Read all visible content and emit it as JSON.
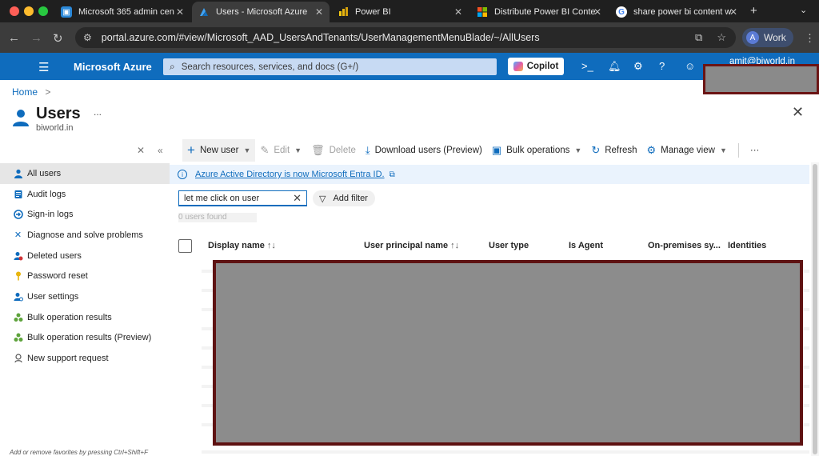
{
  "browser": {
    "tabs": [
      {
        "label": "Microsoft 365 admin cen",
        "active": false
      },
      {
        "label": "Users - Microsoft Azure",
        "active": true
      },
      {
        "label": "Power BI",
        "active": false
      },
      {
        "label": "Distribute Power BI Conte",
        "active": false
      },
      {
        "label": "share power bi content w",
        "active": false
      }
    ],
    "new_tab": "+",
    "url": "portal.azure.com/#view/Microsoft_AAD_UsersAndTenants/UserManagementMenuBlade/~/AllUsers",
    "profile": {
      "initial": "A",
      "label": "Work"
    }
  },
  "azure_header": {
    "brand": "Microsoft Azure",
    "search_placeholder": "Search resources, services, and docs (G+/)",
    "copilot_label": "Copilot",
    "account": "amit@biworld.in"
  },
  "breadcrumb": {
    "home": "Home",
    "separator": ">"
  },
  "page": {
    "title": "Users",
    "more": "...",
    "tenant": "biworld.in",
    "close": "✕"
  },
  "toolbar": {
    "new_user": "New user",
    "edit": "Edit",
    "delete": "Delete",
    "download": "Download users (Preview)",
    "bulk": "Bulk operations",
    "refresh": "Refresh",
    "manage_view": "Manage view",
    "more": "···"
  },
  "sidebar": {
    "items": [
      {
        "label": "All users",
        "icon": "user-icon",
        "active": true
      },
      {
        "label": "Audit logs",
        "icon": "audit-log-icon",
        "active": false
      },
      {
        "label": "Sign-in logs",
        "icon": "sign-in-icon",
        "active": false
      },
      {
        "label": "Diagnose and solve problems",
        "icon": "wrench-icon",
        "active": false
      },
      {
        "label": "Deleted users",
        "icon": "deleted-user-icon",
        "active": false
      },
      {
        "label": "Password reset",
        "icon": "key-icon",
        "active": false
      },
      {
        "label": "User settings",
        "icon": "user-settings-icon",
        "active": false
      },
      {
        "label": "Bulk operation results",
        "icon": "bulk-icon",
        "active": false
      },
      {
        "label": "Bulk operation results (Preview)",
        "icon": "bulk-preview-icon",
        "active": false
      },
      {
        "label": "New support request",
        "icon": "support-icon",
        "active": false
      }
    ],
    "footer": "Add or remove favorites by pressing Ctrl+Shift+F"
  },
  "banner": {
    "link_text": "Azure Active Directory is now Microsoft Entra ID."
  },
  "filter": {
    "search_value": "let me click on user",
    "add_filter": "Add filter",
    "results": "0 users found"
  },
  "grid": {
    "columns": [
      "Display name",
      "User principal name",
      "User type",
      "Is Agent",
      "On-premises sy...",
      "Identities"
    ],
    "sortable": [
      true,
      true,
      false,
      false,
      false,
      false
    ],
    "sort_glyph": "↑↓"
  },
  "colors": {
    "azure_blue": "#0f6cbd",
    "redaction": "#8c8c8c",
    "redaction_border": "#5e1212"
  }
}
